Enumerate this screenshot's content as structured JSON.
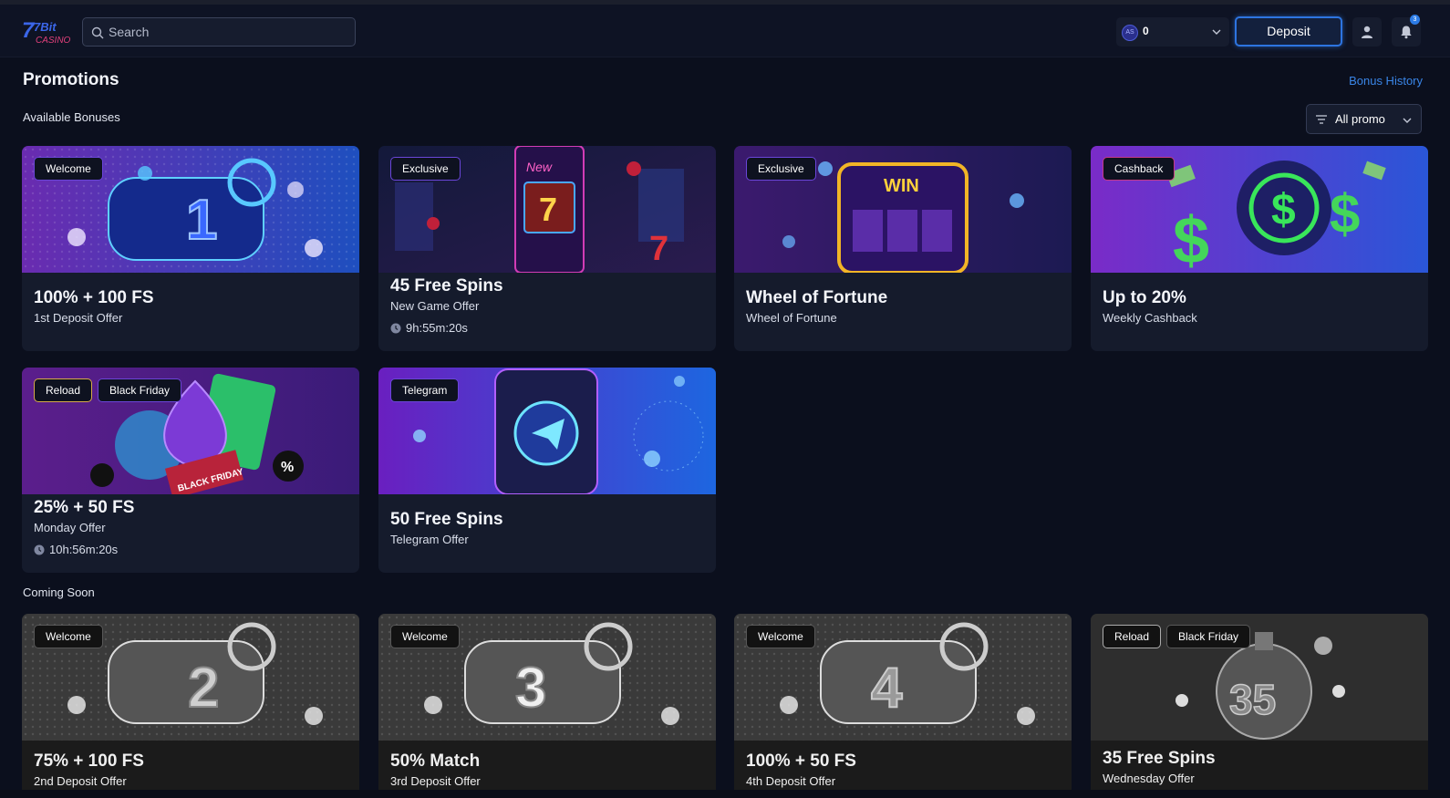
{
  "header": {
    "logo": {
      "text": "7Bit",
      "subtext": "CASINO"
    },
    "search_placeholder": "Search",
    "balance": {
      "currency_icon": "AS",
      "amount": "0"
    },
    "deposit_label": "Deposit",
    "notification_count": "3"
  },
  "page": {
    "title": "Promotions",
    "bonus_history_label": "Bonus History",
    "available_label": "Available Bonuses",
    "filter_label": "All promo",
    "coming_soon_label": "Coming Soon"
  },
  "available": [
    {
      "tags": [
        "Welcome"
      ],
      "title": "100% + 100 FS",
      "subtitle": "1st Deposit Offer",
      "timer": "",
      "art_text": "1"
    },
    {
      "tags": [
        "Exclusive"
      ],
      "title": "45 Free Spins",
      "subtitle": "New Game Offer",
      "timer": "9h:55m:20s",
      "art_text": "New"
    },
    {
      "tags": [
        "Exclusive"
      ],
      "title": "Wheel of Fortune",
      "subtitle": "Wheel of Fortune",
      "timer": "",
      "art_text": "WIN"
    },
    {
      "tags": [
        "Cashback"
      ],
      "title": "Up to 20%",
      "subtitle": "Weekly Cashback",
      "timer": "",
      "art_text": "$"
    },
    {
      "tags": [
        "Reload",
        "Black Friday"
      ],
      "title": "25% + 50 FS",
      "subtitle": "Monday Offer",
      "timer": "10h:56m:20s",
      "art_text": "BLACK FRIDAY"
    },
    {
      "tags": [
        "Telegram"
      ],
      "title": "50 Free Spins",
      "subtitle": "Telegram Offer",
      "timer": "",
      "art_text": ""
    }
  ],
  "coming_soon": [
    {
      "tags": [
        "Welcome"
      ],
      "title": "75% + 100 FS",
      "subtitle": "2nd Deposit Offer",
      "art_text": "2"
    },
    {
      "tags": [
        "Welcome"
      ],
      "title": "50% Match",
      "subtitle": "3rd Deposit Offer",
      "art_text": "3"
    },
    {
      "tags": [
        "Welcome"
      ],
      "title": "100% + 50 FS",
      "subtitle": "4th Deposit Offer",
      "art_text": "4"
    },
    {
      "tags": [
        "Reload",
        "Black Friday"
      ],
      "title": "35 Free Spins",
      "subtitle": "Wednesday Offer",
      "art_text": "35"
    }
  ],
  "colors": {
    "background": "#0b0f1d",
    "card": "#151b2c",
    "accent_blue": "#2d74e0",
    "tag_purple": "#6a46d8",
    "tag_pink": "#c53a86",
    "tag_gold": "#d6a94a"
  },
  "icons": {
    "search": "search-icon",
    "chevron": "chevron-down-icon",
    "user": "user-icon",
    "bell": "bell-icon",
    "filter": "filter-icon",
    "clock": "clock-icon"
  }
}
